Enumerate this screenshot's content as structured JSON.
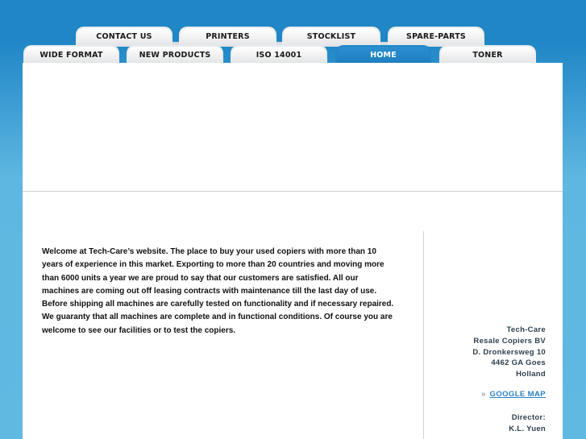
{
  "nav": {
    "row1": [
      {
        "label": "CONTACT US"
      },
      {
        "label": "PRINTERS"
      },
      {
        "label": "STOCKLIST"
      },
      {
        "label": "SPARE-PARTS"
      }
    ],
    "row2": [
      {
        "label": "WIDE FORMAT"
      },
      {
        "label": "NEW PRODUCTS"
      },
      {
        "label": "ISO 14001"
      },
      {
        "label": "HOME",
        "active": true
      },
      {
        "label": "TONER"
      }
    ]
  },
  "content": {
    "intro": "Welcome at Tech-Care’s website. The place to buy your used copiers with more than 10 years of experience in this market. Exporting to more than 20 countries and moving more than 6000 units a year we are proud to say that our customers are satisfied. All our machines are coming out off leasing contracts with maintenance till the last day of use. Before shipping all machines are carefully tested on functionality and if necessary repaired. We guaranty that all machines are complete and in functional conditions. Of course you are welcome to see our facilities or to test the copiers."
  },
  "sidebar": {
    "address": [
      "Tech-Care",
      "Resale Copiers BV",
      "D. Dronkersweg 10",
      "4462 GA Goes",
      "Holland"
    ],
    "map_link": {
      "icon": "double-chevron-right-icon",
      "label": "GOOGLE MAP"
    },
    "director_label": "Director:",
    "director_name": "K.L. Yuen"
  },
  "colors": {
    "header_blue": "#2086c6",
    "side_blue": "#5fb9e1",
    "active_tab": "#1e7fc0",
    "link": "#2a82c4"
  }
}
